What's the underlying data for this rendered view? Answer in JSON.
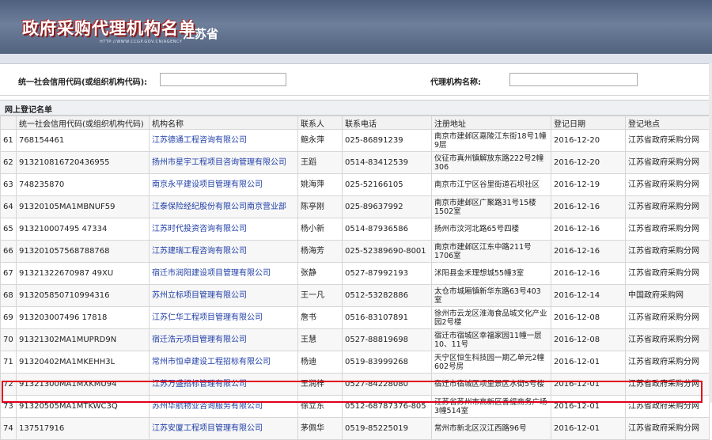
{
  "header": {
    "title": "政府采购代理机构名单",
    "province": "江苏省",
    "url_text": "HTTP://WWW.CCGP.GOV.CN/AGENCY"
  },
  "search": {
    "credit_code_label": "统一社会信用代码(或组织机构代码):",
    "credit_code_value": "",
    "agency_name_label": "代理机构名称:",
    "agency_name_value": ""
  },
  "section_title": "网上登记名单",
  "table": {
    "headers": [
      "",
      "统一社会信用代码(或组织机构代码)",
      "机构名称",
      "联系人",
      "联系电话",
      "注册地址",
      "登记日期",
      "登记地点"
    ],
    "rows": [
      {
        "no": "61",
        "code": "768154461",
        "name": "江苏德通工程咨询有限公司",
        "contact": "鲍永萍",
        "phone": "025-86891239",
        "address": "南京市建邺区嘉陵江东街18号1幢9层",
        "date": "2016-12-20",
        "place": "江苏省政府采购分网"
      },
      {
        "no": "62",
        "code": "913210816720436955",
        "name": "扬州市星宇工程项目咨询管理有限公司",
        "contact": "王蹈",
        "phone": "0514-83412539",
        "address": "仪征市真州镇解放东路222号2幢306",
        "date": "2016-12-20",
        "place": "江苏省政府采购分网"
      },
      {
        "no": "63",
        "code": "748235870",
        "name": "南京永平建设项目管理有限公司",
        "contact": "姚海萍",
        "phone": "025-52166105",
        "address": "南京市江宁区谷里街道石坝社区",
        "date": "2016-12-19",
        "place": "江苏省政府采购分网"
      },
      {
        "no": "64",
        "code": "91320105MA1MBNUF59",
        "name": "江泰保险经纪股份有限公司南京营业部",
        "contact": "陈亭刚",
        "phone": "025-89637992",
        "address": "南京市建邺区广聚路31号15楼1502室",
        "date": "2016-12-16",
        "place": "江苏省政府采购分网"
      },
      {
        "no": "65",
        "code": "913210007495 47334",
        "name": "江苏时代投资咨询有限公司",
        "contact": "杨小新",
        "phone": "0514-87936586",
        "address": "扬州市汶河北路65号四楼",
        "date": "2016-12-16",
        "place": "江苏省政府采购分网"
      },
      {
        "no": "66",
        "code": "913201057568788768",
        "name": "江苏建瑞工程咨询有限公司",
        "contact": "杨海芳",
        "phone": "025-52389690-8001",
        "address": "南京市建邺区江东中路211号1706室",
        "date": "2016-12-16",
        "place": "江苏省政府采购分网"
      },
      {
        "no": "67",
        "code": "91321322670987 49XU",
        "name": "宿迁市润阳建设项目管理有限公司",
        "contact": "张静",
        "phone": "0527-87992193",
        "address": "沭阳县金禾理想城55幢3室",
        "date": "2016-12-16",
        "place": "江苏省政府采购分网"
      },
      {
        "no": "68",
        "code": "913205850710994316",
        "name": "苏州立标项目管理有限公司",
        "contact": "王一凡",
        "phone": "0512-53282886",
        "address": "太仓市城厢镇新华东路63号403室",
        "date": "2016-12-14",
        "place": "中国政府采购网"
      },
      {
        "no": "69",
        "code": "913203007496 17818",
        "name": "江苏仁华工程项目管理有限公司",
        "contact": "詹书",
        "phone": "0516-83107891",
        "address": "徐州市云龙区淮海食品城文化产业园2号楼",
        "date": "2016-12-08",
        "place": "江苏省政府采购分网"
      },
      {
        "no": "70",
        "code": "91321302MA1MUPRD9N",
        "name": "宿迁浩元项目管理有限公司",
        "contact": "王慧",
        "phone": "0527-88819698",
        "address": "宿迁市宿城区幸福家园11幢一层10、11号",
        "date": "2016-12-08",
        "place": "江苏省政府采购分网"
      },
      {
        "no": "71",
        "code": "91320402MA1MKEHH3L",
        "name": "常州市恒卓建设工程招标有限公司",
        "contact": "杨迪",
        "phone": "0519-83999268",
        "address": "天宁区恒生科技园一期乙单元2幢602号房",
        "date": "2016-12-01",
        "place": "江苏省政府采购分网"
      },
      {
        "no": "72",
        "code": "91321300MA1MXKMU94",
        "name": "江苏万盛招标管理有限公司",
        "contact": "王润梓",
        "phone": "0527-84228080",
        "address": "宿迁市宿城区项里景区水街5号楼",
        "date": "2016-12-01",
        "place": "江苏省政府采购分网"
      },
      {
        "no": "73",
        "code": "91320505MA1MTKWC3Q",
        "name": "苏州华航物业咨询服务有限公司",
        "contact": "徐立东",
        "phone": "0512-68787376-805",
        "address": "江苏省苏州市高新区香缇商务广场3幢514室",
        "date": "2016-12-01",
        "place": "江苏省政府采购分网"
      },
      {
        "no": "74",
        "code": "137517916",
        "name": "江苏安厦工程项目管理有限公司",
        "contact": "茅佩华",
        "phone": "0519-85225019",
        "address": "常州市新北区汉江西路96号",
        "date": "2016-12-01",
        "place": "江苏省政府采购分网"
      }
    ]
  }
}
